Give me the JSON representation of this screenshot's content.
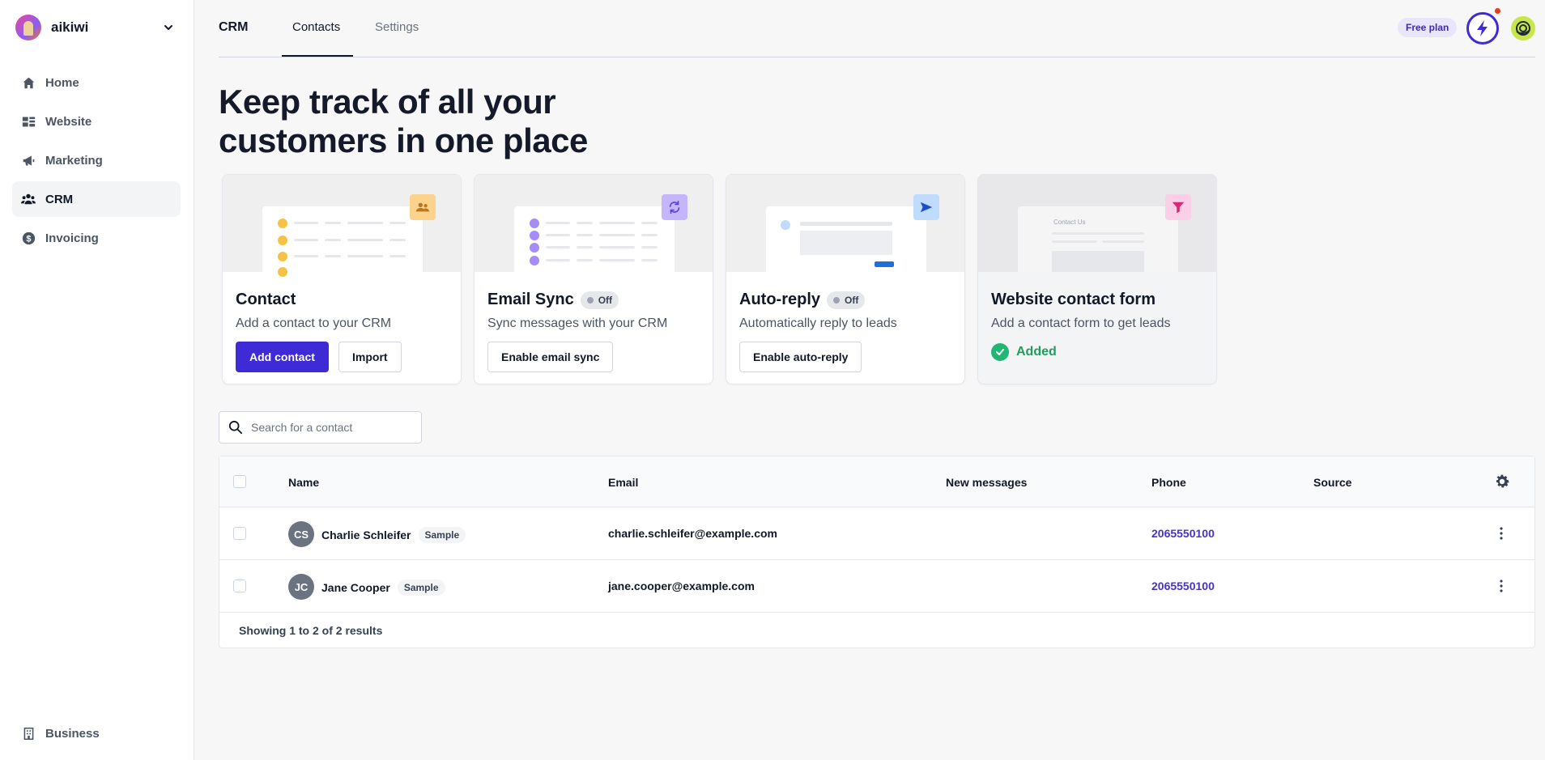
{
  "workspace": {
    "name": "aikiwi"
  },
  "sidebar": {
    "items": [
      {
        "label": "Home",
        "icon": "home-icon"
      },
      {
        "label": "Website",
        "icon": "website-icon"
      },
      {
        "label": "Marketing",
        "icon": "megaphone-icon"
      },
      {
        "label": "CRM",
        "icon": "users-icon",
        "active": true
      },
      {
        "label": "Invoicing",
        "icon": "dollar-icon"
      }
    ],
    "bottom": {
      "label": "Business",
      "icon": "building-icon"
    }
  },
  "header": {
    "title": "CRM",
    "tabs": [
      {
        "label": "Contacts",
        "active": true
      },
      {
        "label": "Settings",
        "active": false
      }
    ],
    "plan_badge": "Free plan"
  },
  "hero": {
    "title": "Keep track of all your customers in one place"
  },
  "cards": [
    {
      "title": "Contact",
      "description": "Add a contact to your CRM",
      "primary_button": "Add contact",
      "secondary_button": "Import"
    },
    {
      "title": "Email Sync",
      "status": "Off",
      "description": "Sync messages with your CRM",
      "button": "Enable email sync"
    },
    {
      "title": "Auto-reply",
      "status": "Off",
      "description": "Automatically reply to leads",
      "button": "Enable auto-reply"
    },
    {
      "title": "Website contact form",
      "description": "Add a contact form to get leads",
      "state": "Added",
      "preview_label": "Contact Us"
    }
  ],
  "search": {
    "placeholder": "Search for a contact",
    "value": ""
  },
  "table": {
    "columns": [
      "Name",
      "Email",
      "New messages",
      "Phone",
      "Source"
    ],
    "rows": [
      {
        "initials": "CS",
        "name": "Charlie Schleifer",
        "tag": "Sample",
        "email": "charlie.schleifer@example.com",
        "new_messages": "",
        "phone": "2065550100",
        "source": ""
      },
      {
        "initials": "JC",
        "name": "Jane Cooper",
        "tag": "Sample",
        "email": "jane.cooper@example.com",
        "new_messages": "",
        "phone": "2065550100",
        "source": ""
      }
    ],
    "footer": "Showing 1 to 2 of 2 results"
  },
  "colors": {
    "accent": "#3f2bd6",
    "phone_link": "#4733c8",
    "added_green": "#22b573",
    "notification": "#e23d1f"
  }
}
